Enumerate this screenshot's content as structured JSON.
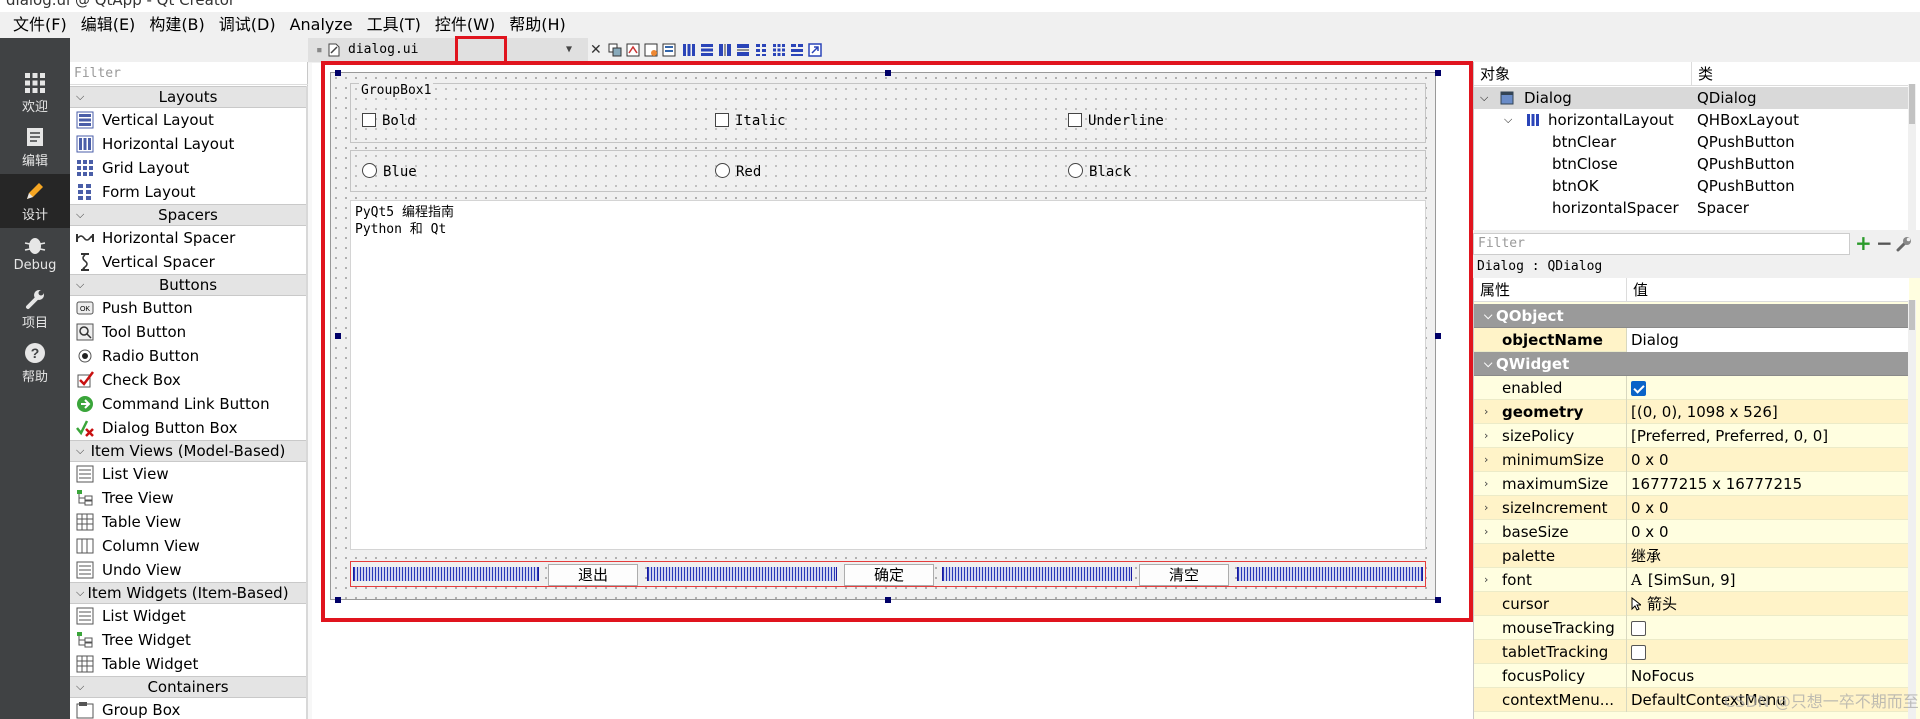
{
  "window": {
    "title": "dialog.ui @ QtApp - Qt Creator"
  },
  "menu": [
    "文件(F)",
    "编辑(E)",
    "构建(B)",
    "调试(D)",
    "Analyze",
    "工具(T)",
    "控件(W)",
    "帮助(H)"
  ],
  "modes": [
    {
      "label": "欢迎",
      "icon": "welcome-grid-icon"
    },
    {
      "label": "编辑",
      "icon": "edit-document-icon"
    },
    {
      "label": "设计",
      "icon": "design-pencil-icon"
    },
    {
      "label": "Debug",
      "icon": "debug-bug-icon"
    },
    {
      "label": "项目",
      "icon": "project-wrench-icon"
    },
    {
      "label": "帮助",
      "icon": "help-question-icon"
    }
  ],
  "file_tab": {
    "name": "dialog.ui"
  },
  "widget_box": {
    "filter_placeholder": "Filter",
    "categories": {
      "layouts": "Layouts",
      "spacers": "Spacers",
      "buttons": "Buttons",
      "item_views": "Item Views (Model-Based)",
      "item_widgets": "Item Widgets (Item-Based)",
      "containers": "Containers"
    },
    "layouts": [
      "Vertical Layout",
      "Horizontal Layout",
      "Grid Layout",
      "Form Layout"
    ],
    "spacers": [
      "Horizontal Spacer",
      "Vertical Spacer"
    ],
    "buttons": [
      "Push Button",
      "Tool Button",
      "Radio Button",
      "Check Box",
      "Command Link Button",
      "Dialog Button Box"
    ],
    "item_views": [
      "List View",
      "Tree View",
      "Table View",
      "Column View",
      "Undo View"
    ],
    "item_widgets": [
      "List Widget",
      "Tree Widget",
      "Table Widget"
    ],
    "containers": [
      "Group Box"
    ]
  },
  "form": {
    "groupbox_title": "GroupBox1",
    "checkboxes": [
      "Bold",
      "Italic",
      "Underline"
    ],
    "radios": [
      "Blue",
      "Red",
      "Black"
    ],
    "text_lines": [
      "PyQt5 编程指南",
      "Python 和 Qt"
    ],
    "buttons": [
      "退出",
      "确定",
      "清空"
    ]
  },
  "object_inspector": {
    "headers": [
      "对象",
      "类"
    ],
    "rows": [
      {
        "name": "Dialog",
        "cls": "QDialog"
      },
      {
        "name": "horizontalLayout",
        "cls": "QHBoxLayout"
      },
      {
        "name": "btnClear",
        "cls": "QPushButton"
      },
      {
        "name": "btnClose",
        "cls": "QPushButton"
      },
      {
        "name": "btnOK",
        "cls": "QPushButton"
      },
      {
        "name": "horizontalSpacer",
        "cls": "Spacer"
      }
    ]
  },
  "property_editor": {
    "filter_placeholder": "Filter",
    "object_label": "Dialog : QDialog",
    "headers": [
      "属性",
      "值"
    ],
    "sections": [
      "QObject",
      "QWidget"
    ],
    "rows": [
      {
        "key": "objectName",
        "value": "Dialog"
      },
      {
        "key": "enabled",
        "value": ""
      },
      {
        "key": "geometry",
        "value": "[(0, 0), 1098 x 526]"
      },
      {
        "key": "sizePolicy",
        "value": "[Preferred, Preferred, 0, 0]"
      },
      {
        "key": "minimumSize",
        "value": "0 x 0"
      },
      {
        "key": "maximumSize",
        "value": "16777215 x 16777215"
      },
      {
        "key": "sizeIncrement",
        "value": "0 x 0"
      },
      {
        "key": "baseSize",
        "value": "0 x 0"
      },
      {
        "key": "palette",
        "value": "继承"
      },
      {
        "key": "font",
        "value": "[SimSun, 9]"
      },
      {
        "key": "cursor",
        "value": "箭头"
      },
      {
        "key": "mouseTracking",
        "value": ""
      },
      {
        "key": "tabletTracking",
        "value": ""
      },
      {
        "key": "focusPolicy",
        "value": "NoFocus"
      },
      {
        "key": "contextMenu...",
        "value": "DefaultContextMenu"
      }
    ]
  },
  "watermark": "CSDN @只想一卒不期而至~",
  "colors": {
    "highlight": "#e0141e",
    "modebar": "#404244",
    "property_bg": "#fffee0",
    "section_bg": "#9a9a9a"
  }
}
